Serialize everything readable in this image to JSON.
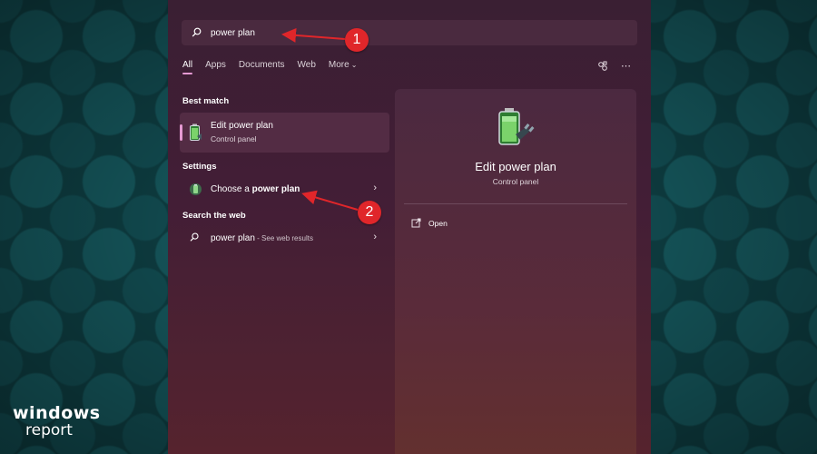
{
  "brand": {
    "line1": "windows",
    "line2": "report"
  },
  "search": {
    "query": "power plan"
  },
  "tabs": [
    {
      "label": "All",
      "active": true
    },
    {
      "label": "Apps"
    },
    {
      "label": "Documents"
    },
    {
      "label": "Web"
    },
    {
      "label": "More"
    }
  ],
  "icons": {
    "search": "search-icon",
    "share": "share-icon",
    "more": "more-options-icon",
    "battery": "battery-icon",
    "web": "search-icon",
    "open": "open-external-icon",
    "chevron": "chevron-right-icon"
  },
  "sections": {
    "best_match": "Best match",
    "settings": "Settings",
    "web": "Search the web"
  },
  "best_match": {
    "title": "Edit power plan",
    "subtitle": "Control panel"
  },
  "settings_item": {
    "prefix": "Choose a ",
    "bold": "power plan"
  },
  "web_item": {
    "query": "power plan",
    "suffix": " - See web results"
  },
  "detail": {
    "title": "Edit power plan",
    "subtitle": "Control panel",
    "action": "Open"
  },
  "annotations": {
    "step1": "1",
    "step2": "2"
  },
  "colors": {
    "accent": "#e59ad2",
    "badge": "#e0262a",
    "panel": "#431e36"
  }
}
